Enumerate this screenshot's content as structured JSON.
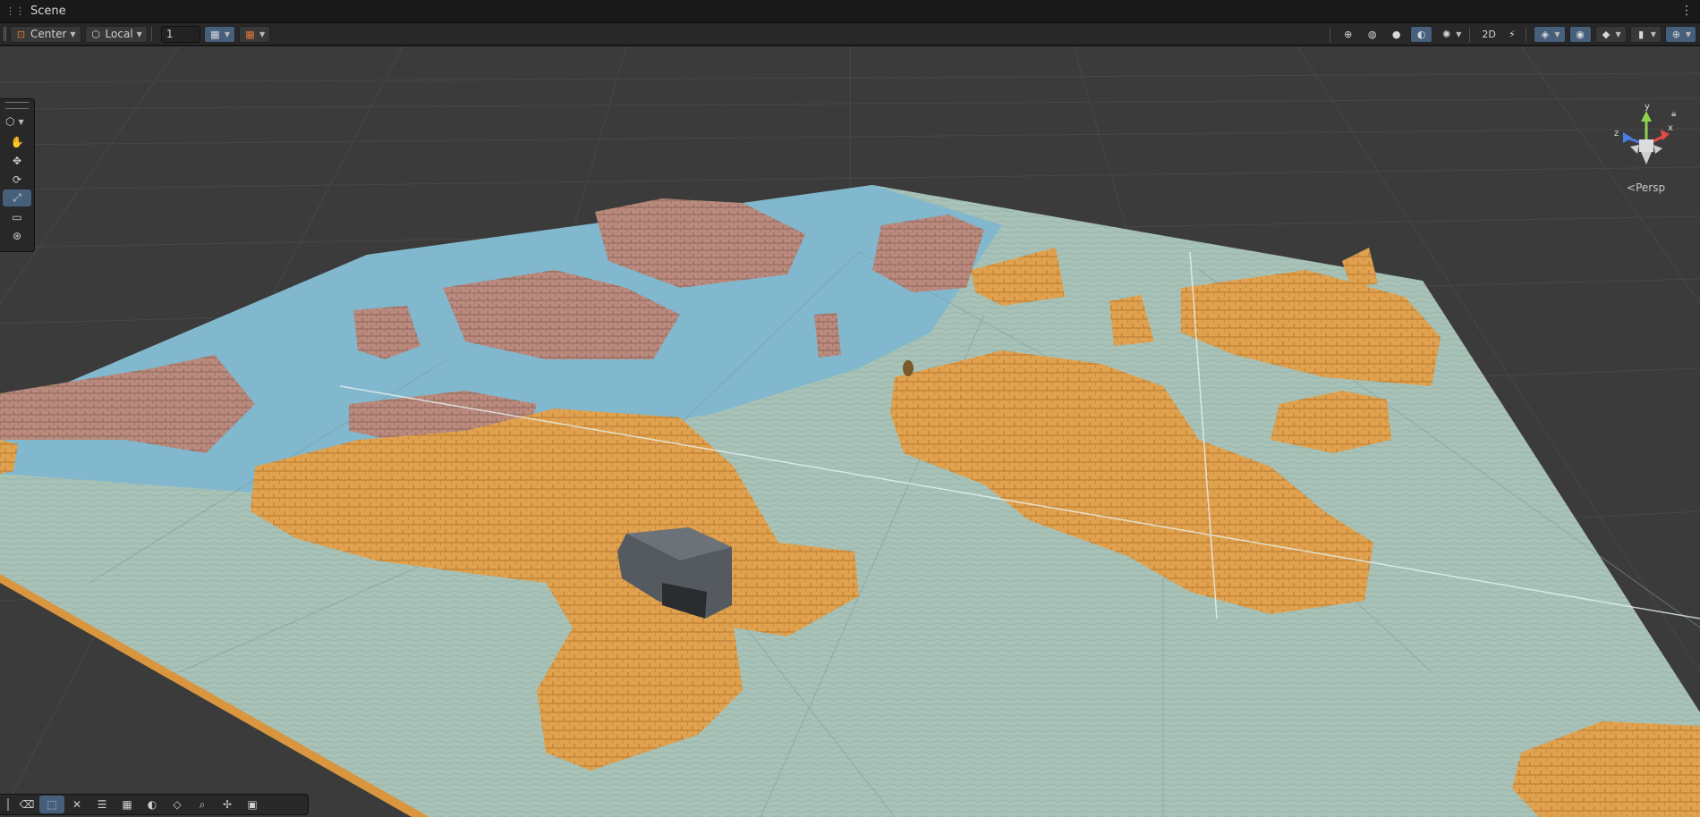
{
  "window": {
    "title": "Scene",
    "menu_icon": "kebab-menu-icon"
  },
  "toolbar": {
    "pivot_mode": "Center",
    "pivot_rotation": "Local",
    "grid_snap_value": "1",
    "right_icons": [
      "wireframe-shading-icon",
      "shaded-wireframe-icon",
      "shaded-icon",
      "unlit-icon",
      "gizmos-icon",
      "2d-toggle-icon",
      "audio-toggle-icon",
      "effects-icon",
      "visibility-icon",
      "layers-icon",
      "camera-icon",
      "gizmo-toggle-icon"
    ]
  },
  "tools": {
    "items": [
      {
        "name": "hand-tool",
        "glyph": "✋",
        "active": false
      },
      {
        "name": "move-tool",
        "glyph": "✥",
        "active": false
      },
      {
        "name": "rotate-tool",
        "glyph": "⟳",
        "active": false
      },
      {
        "name": "scale-tool",
        "glyph": "⤢",
        "active": true
      },
      {
        "name": "rect-tool",
        "glyph": "▭",
        "active": false
      },
      {
        "name": "transform-tool",
        "glyph": "⊛",
        "active": false
      }
    ]
  },
  "bottom_overlay": {
    "items": [
      {
        "name": "eraser-icon",
        "glyph": "⌫",
        "active": false
      },
      {
        "name": "select-icon",
        "glyph": "⬚",
        "active": true
      },
      {
        "name": "cross-icon",
        "glyph": "✕",
        "active": false
      },
      {
        "name": "settings-icon",
        "glyph": "☰",
        "active": false
      },
      {
        "name": "grid-icon",
        "glyph": "▦",
        "active": false
      },
      {
        "name": "moon-icon",
        "glyph": "◐",
        "active": false
      },
      {
        "name": "layers-icon",
        "glyph": "◇",
        "active": false
      },
      {
        "name": "search-icon",
        "glyph": "⌕",
        "active": false
      },
      {
        "name": "move-icon",
        "glyph": "✢",
        "active": false
      },
      {
        "name": "camera-icon",
        "glyph": "▣",
        "active": false
      }
    ]
  },
  "gizmo": {
    "axis_y": "y",
    "axis_x": "x",
    "axis_z": "z",
    "projection": "Persp"
  },
  "colors": {
    "water": "#7fb7cf",
    "ground": "#a8c2b8",
    "sand": "#e0a24e",
    "brick": "#b98a7d",
    "grid": "#4a4a4a",
    "accent": "#46607c"
  }
}
